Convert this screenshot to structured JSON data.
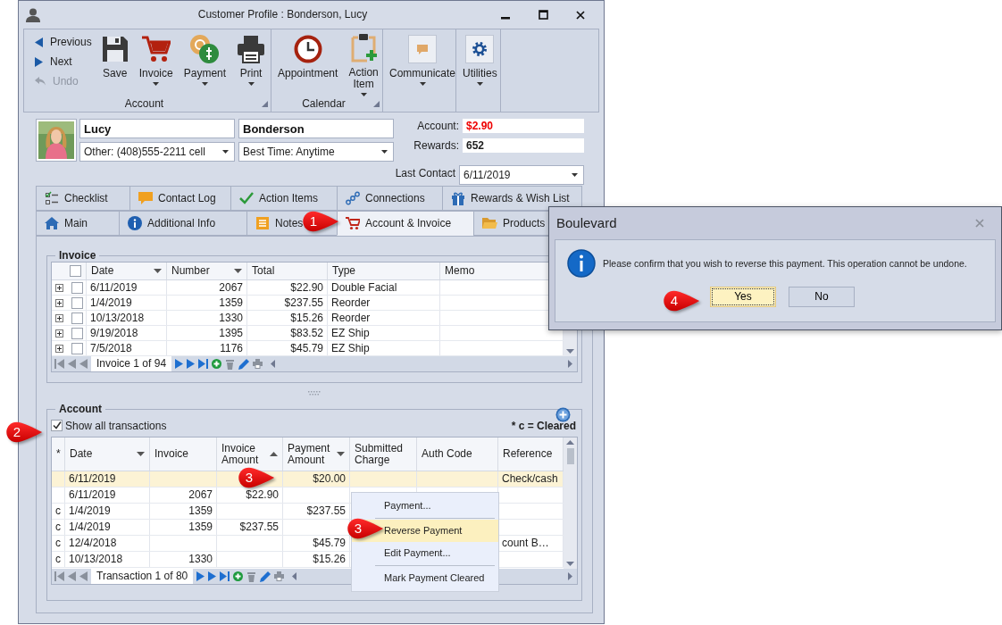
{
  "window": {
    "title": "Customer Profile : Bonderson, Lucy"
  },
  "ribbon": {
    "groups": [
      {
        "label": "Account",
        "launcher": true,
        "items": [
          {
            "kind": "small",
            "label": "Previous",
            "disabled": false
          },
          {
            "kind": "small",
            "label": "Next",
            "disabled": false
          },
          {
            "kind": "small",
            "label": "Undo",
            "disabled": true
          },
          {
            "kind": "large",
            "label": "Save",
            "disabled": false,
            "dropdown": false
          },
          {
            "kind": "large",
            "label": "Invoice",
            "disabled": false,
            "dropdown": true
          },
          {
            "kind": "large",
            "label": "Payment",
            "disabled": false,
            "dropdown": true
          },
          {
            "kind": "large",
            "label": "Print",
            "disabled": false,
            "dropdown": true
          }
        ]
      },
      {
        "label": "Calendar",
        "launcher": true,
        "items": [
          {
            "kind": "large",
            "label": "Appointment",
            "disabled": false,
            "dropdown": false
          },
          {
            "kind": "large",
            "label": "Action Item",
            "disabled": false,
            "dropdown": true
          }
        ]
      },
      {
        "launcher": false,
        "items": [
          {
            "kind": "large",
            "label": "Communicate",
            "disabled": false,
            "dropdown": true
          }
        ]
      },
      {
        "launcher": false,
        "items": [
          {
            "kind": "large",
            "label": "Utilities",
            "disabled": false,
            "dropdown": true
          }
        ]
      }
    ]
  },
  "profile": {
    "first_name": "Lucy",
    "last_name": "Bonderson",
    "phone": "Other: (408)555-2211 cell",
    "best_time": "Best Time: Anytime",
    "account_label": "Account:",
    "account_value": "$2.90",
    "rewards_label": "Rewards:",
    "rewards_value": "652",
    "last_contact_label": "Last Contact",
    "last_contact_value": "6/11/2019"
  },
  "tab_rows": [
    [
      {
        "label": "Checklist",
        "selected": false
      },
      {
        "label": "Contact Log",
        "selected": false
      },
      {
        "label": "Action Items",
        "selected": false
      },
      {
        "label": "Connections",
        "selected": false
      },
      {
        "label": "Rewards & Wish List",
        "selected": false
      }
    ],
    [
      {
        "label": "Main",
        "selected": false
      },
      {
        "label": "Additional Info",
        "selected": false
      },
      {
        "label": "Notes",
        "selected": false
      },
      {
        "label": "Account & Invoice",
        "selected": true
      },
      {
        "label": "Products",
        "selected": false
      }
    ]
  ],
  "invoice": {
    "title": "Invoice",
    "header_checked": false,
    "columns": [
      {
        "label": "Date",
        "dropdown": true
      },
      {
        "label": "Number",
        "dropdown": true
      },
      {
        "label": "Total",
        "dropdown": false
      },
      {
        "label": "Type",
        "dropdown": false
      },
      {
        "label": "Memo",
        "dropdown": false
      }
    ],
    "rows": [
      {
        "expanded": false,
        "checked": false,
        "cells": [
          "6/11/2019",
          "2067",
          "$22.90",
          "Double Facial"
        ]
      },
      {
        "expanded": false,
        "checked": false,
        "cells": [
          "1/4/2019",
          "1359",
          "$237.55",
          "Reorder"
        ]
      },
      {
        "expanded": false,
        "checked": false,
        "cells": [
          "10/13/2018",
          "1330",
          "$15.26",
          "Reorder"
        ]
      },
      {
        "expanded": false,
        "checked": false,
        "cells": [
          "9/19/2018",
          "1395",
          "$83.52",
          "EZ Ship"
        ]
      },
      {
        "expanded": false,
        "checked": false,
        "cells": [
          "7/5/2018",
          "1176",
          "$45.79",
          "EZ Ship"
        ]
      }
    ],
    "navigator": "Invoice 1 of 94"
  },
  "account": {
    "title": "Account",
    "show_all": {
      "label": "Show all transactions",
      "checked": true
    },
    "note": "* c = Cleared",
    "columns": [
      {
        "label": "*"
      },
      {
        "label": "Date",
        "dropdown": true,
        "sort_ascending": false
      },
      {
        "label": "Invoice",
        "dropdown": false,
        "sort_ascending": false
      },
      {
        "label": "Invoice Amount",
        "dropdown": false,
        "sort_ascending": true
      },
      {
        "label": "Payment Amount",
        "dropdown": true,
        "sort_ascending": false
      },
      {
        "label": "Submitted Charge",
        "dropdown": false,
        "sort_ascending": false
      },
      {
        "label": "Auth Code",
        "dropdown": false,
        "sort_ascending": false
      },
      {
        "label": "Reference",
        "dropdown": false,
        "sort_ascending": false
      }
    ],
    "rows": [
      {
        "selected": true,
        "date": "6/11/2019",
        "payment_amount": "$20.00",
        "reference": "Check/cash"
      },
      {
        "selected": false,
        "date": "6/11/2019",
        "invoice": "2067",
        "invoice_amount": "$22.90"
      },
      {
        "selected": false,
        "flag": "c",
        "date": "1/4/2019",
        "invoice": "1359",
        "payment_amount": "$237.55"
      },
      {
        "selected": false,
        "flag": "c",
        "date": "1/4/2019",
        "invoice": "1359",
        "invoice_amount": "$237.55"
      },
      {
        "selected": false,
        "flag": "c",
        "date": "12/4/2018",
        "payment_amount": "$45.79",
        "reference": "count B…"
      },
      {
        "selected": false,
        "flag": "c",
        "date": "10/13/2018",
        "invoice": "1330",
        "payment_amount": "$15.26"
      }
    ],
    "navigator": "Transaction 1 of 80"
  },
  "context_menu": {
    "items": [
      {
        "label": "Payment...",
        "selected": false,
        "separator_after": true
      },
      {
        "label": "Reverse Payment",
        "selected": true,
        "separator_after": false
      },
      {
        "label": "Edit Payment...",
        "selected": false,
        "separator_after": true
      },
      {
        "label": "Mark Payment Cleared",
        "selected": false,
        "separator_after": false
      }
    ]
  },
  "dialog": {
    "title": "Boulevard",
    "message": "Please confirm that you wish to reverse this payment. This operation cannot be undone.",
    "buttons": [
      {
        "label": "Yes",
        "selected": true
      },
      {
        "label": "No",
        "selected": false
      }
    ]
  },
  "callouts": [
    {
      "number": "1"
    },
    {
      "number": "2"
    },
    {
      "number": "3"
    },
    {
      "number": "3"
    },
    {
      "number": "4"
    }
  ]
}
